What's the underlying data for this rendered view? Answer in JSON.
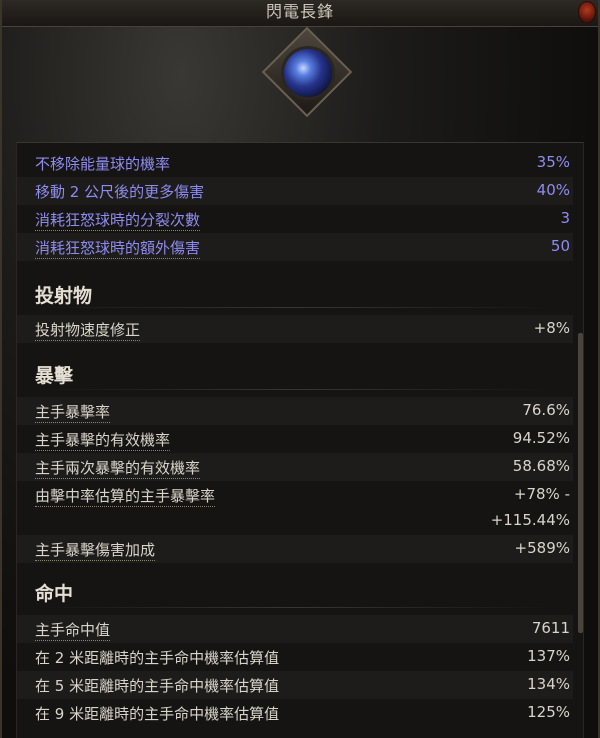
{
  "window": {
    "title": "閃電長鋒"
  },
  "modifiers": [
    {
      "label": "不移除能量球的機率",
      "value": "35%"
    },
    {
      "label": "移動 2 公尺後的更多傷害",
      "value": "40%"
    },
    {
      "label": "消耗狂怒球時的分裂次數",
      "value": "3"
    },
    {
      "label": "消耗狂怒球時的額外傷害",
      "value": "50"
    }
  ],
  "sections": {
    "projectile": {
      "heading": "投射物",
      "rows": [
        {
          "label": "投射物速度修正",
          "value": "+8%"
        }
      ]
    },
    "crit": {
      "heading": "暴擊",
      "rows": [
        {
          "label": "主手暴擊率",
          "value": "76.6%"
        },
        {
          "label": "主手暴擊的有效機率",
          "value": "94.52%"
        },
        {
          "label": "主手兩次暴擊的有效機率",
          "value": "58.68%"
        },
        {
          "label": "由擊中率估算的主手暴擊率",
          "value": "+78% -",
          "value2": "+115.44%"
        },
        {
          "label": "主手暴擊傷害加成",
          "value": "+589%"
        }
      ]
    },
    "accuracy": {
      "heading": "命中",
      "rows": [
        {
          "label": "主手命中值",
          "value": "7611"
        },
        {
          "label": "在 2 米距離時的主手命中機率估算值",
          "value": "137%"
        },
        {
          "label": "在 5 米距離時的主手命中機率估算值",
          "value": "134%"
        },
        {
          "label": "在 9 米距離時的主手命中機率估算值",
          "value": "125%"
        }
      ]
    }
  },
  "icons": {
    "skill": "lightning-spear-skill-icon",
    "close": "close-icon"
  },
  "colors": {
    "modifier_text": "#8e8cf0",
    "normal_text": "#d9d4cb",
    "heading_text": "#e4ded3",
    "background": "#151412"
  }
}
